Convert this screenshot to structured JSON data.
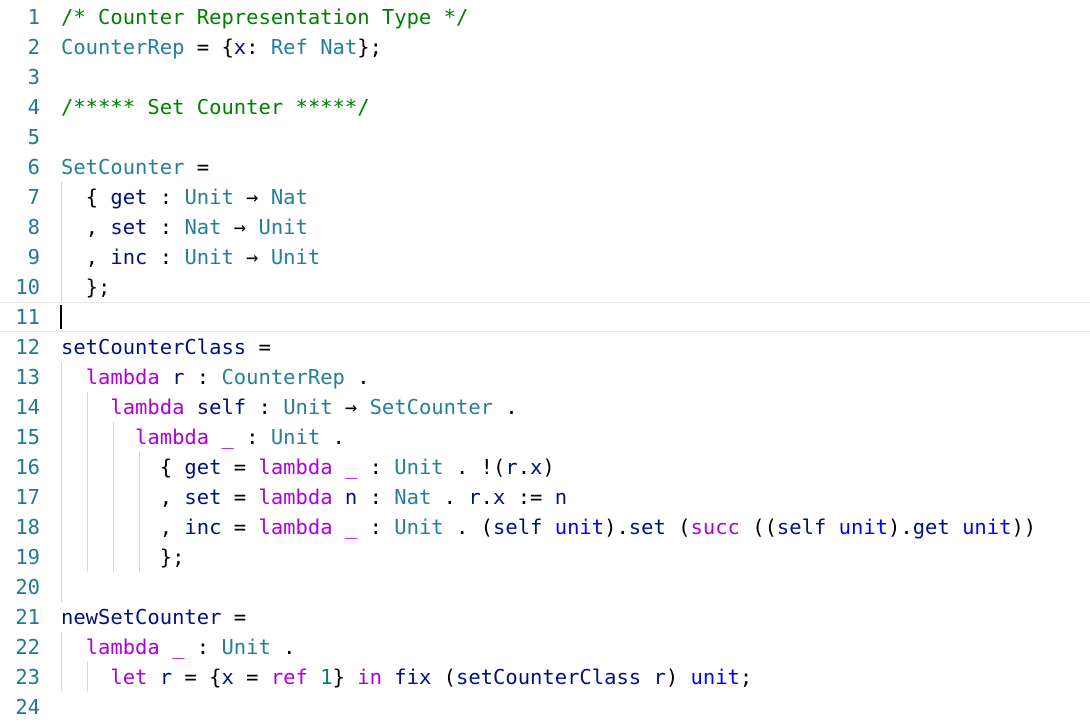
{
  "editor": {
    "current_line": 11,
    "colors": {
      "background": "#ffffff",
      "line_number": "#237893",
      "comment": "#008000",
      "type": "#267f99",
      "keyword": "#af00db",
      "identifier": "#001080",
      "builtin": "#0000ff",
      "number": "#098658"
    },
    "lines": [
      {
        "n": "1",
        "indent": 0,
        "tokens": [
          [
            "comment",
            "/* Counter Representation Type */"
          ]
        ]
      },
      {
        "n": "2",
        "indent": 0,
        "tokens": [
          [
            "type",
            "CounterRep"
          ],
          [
            "plain",
            " = {"
          ],
          [
            "var",
            "x"
          ],
          [
            "plain",
            ": "
          ],
          [
            "type",
            "Ref Nat"
          ],
          [
            "plain",
            "};"
          ]
        ]
      },
      {
        "n": "3",
        "indent": 0,
        "tokens": []
      },
      {
        "n": "4",
        "indent": 0,
        "tokens": [
          [
            "comment",
            "/***** Set Counter *****/"
          ]
        ]
      },
      {
        "n": "5",
        "indent": 0,
        "tokens": []
      },
      {
        "n": "6",
        "indent": 0,
        "tokens": [
          [
            "type",
            "SetCounter"
          ],
          [
            "plain",
            " ="
          ]
        ]
      },
      {
        "n": "7",
        "indent": 1,
        "tokens": [
          [
            "plain",
            "  { "
          ],
          [
            "var",
            "get"
          ],
          [
            "plain",
            " : "
          ],
          [
            "type",
            "Unit"
          ],
          [
            "plain",
            " → "
          ],
          [
            "type",
            "Nat"
          ]
        ]
      },
      {
        "n": "8",
        "indent": 1,
        "tokens": [
          [
            "plain",
            "  , "
          ],
          [
            "var",
            "set"
          ],
          [
            "plain",
            " : "
          ],
          [
            "type",
            "Nat"
          ],
          [
            "plain",
            " → "
          ],
          [
            "type",
            "Unit"
          ]
        ]
      },
      {
        "n": "9",
        "indent": 1,
        "tokens": [
          [
            "plain",
            "  , "
          ],
          [
            "var",
            "inc"
          ],
          [
            "plain",
            " : "
          ],
          [
            "type",
            "Unit"
          ],
          [
            "plain",
            " → "
          ],
          [
            "type",
            "Unit"
          ]
        ]
      },
      {
        "n": "10",
        "indent": 1,
        "tokens": [
          [
            "plain",
            "  };"
          ]
        ]
      },
      {
        "n": "11",
        "indent": 0,
        "tokens": []
      },
      {
        "n": "12",
        "indent": 0,
        "tokens": [
          [
            "var",
            "setCounterClass"
          ],
          [
            "plain",
            " ="
          ]
        ]
      },
      {
        "n": "13",
        "indent": 1,
        "tokens": [
          [
            "plain",
            "  "
          ],
          [
            "kw",
            "lambda"
          ],
          [
            "plain",
            " "
          ],
          [
            "var",
            "r"
          ],
          [
            "plain",
            " : "
          ],
          [
            "type",
            "CounterRep"
          ],
          [
            "plain",
            " ."
          ]
        ]
      },
      {
        "n": "14",
        "indent": 2,
        "tokens": [
          [
            "plain",
            "    "
          ],
          [
            "kw",
            "lambda"
          ],
          [
            "plain",
            " "
          ],
          [
            "var",
            "self"
          ],
          [
            "plain",
            " : "
          ],
          [
            "type",
            "Unit"
          ],
          [
            "plain",
            " → "
          ],
          [
            "type",
            "SetCounter"
          ],
          [
            "plain",
            " ."
          ]
        ]
      },
      {
        "n": "15",
        "indent": 3,
        "tokens": [
          [
            "plain",
            "      "
          ],
          [
            "kw",
            "lambda"
          ],
          [
            "plain",
            " "
          ],
          [
            "kw",
            "_"
          ],
          [
            "plain",
            " : "
          ],
          [
            "type",
            "Unit"
          ],
          [
            "plain",
            " ."
          ]
        ]
      },
      {
        "n": "16",
        "indent": 4,
        "tokens": [
          [
            "plain",
            "        { "
          ],
          [
            "var",
            "get"
          ],
          [
            "plain",
            " = "
          ],
          [
            "kw",
            "lambda"
          ],
          [
            "plain",
            " "
          ],
          [
            "kw",
            "_"
          ],
          [
            "plain",
            " : "
          ],
          [
            "type",
            "Unit"
          ],
          [
            "plain",
            " . !("
          ],
          [
            "var",
            "r"
          ],
          [
            "plain",
            "."
          ],
          [
            "var",
            "x"
          ],
          [
            "plain",
            ")"
          ]
        ]
      },
      {
        "n": "17",
        "indent": 4,
        "tokens": [
          [
            "plain",
            "        , "
          ],
          [
            "var",
            "set"
          ],
          [
            "plain",
            " = "
          ],
          [
            "kw",
            "lambda"
          ],
          [
            "plain",
            " "
          ],
          [
            "var",
            "n"
          ],
          [
            "plain",
            " : "
          ],
          [
            "type",
            "Nat"
          ],
          [
            "plain",
            " . "
          ],
          [
            "var",
            "r"
          ],
          [
            "plain",
            "."
          ],
          [
            "var",
            "x"
          ],
          [
            "plain",
            " := "
          ],
          [
            "var",
            "n"
          ]
        ]
      },
      {
        "n": "18",
        "indent": 4,
        "tokens": [
          [
            "plain",
            "        , "
          ],
          [
            "var",
            "inc"
          ],
          [
            "plain",
            " = "
          ],
          [
            "kw",
            "lambda"
          ],
          [
            "plain",
            " "
          ],
          [
            "kw",
            "_"
          ],
          [
            "plain",
            " : "
          ],
          [
            "type",
            "Unit"
          ],
          [
            "plain",
            " . ("
          ],
          [
            "var",
            "self"
          ],
          [
            "plain",
            " "
          ],
          [
            "blue",
            "unit"
          ],
          [
            "plain",
            ")."
          ],
          [
            "var",
            "set"
          ],
          [
            "plain",
            " ("
          ],
          [
            "kw",
            "succ"
          ],
          [
            "plain",
            " (("
          ],
          [
            "var",
            "self"
          ],
          [
            "plain",
            " "
          ],
          [
            "blue",
            "unit"
          ],
          [
            "plain",
            ")."
          ],
          [
            "var",
            "get"
          ],
          [
            "plain",
            " "
          ],
          [
            "blue",
            "unit"
          ],
          [
            "plain",
            "))"
          ]
        ]
      },
      {
        "n": "19",
        "indent": 4,
        "tokens": [
          [
            "plain",
            "        };"
          ]
        ]
      },
      {
        "n": "20",
        "indent": 1,
        "tokens": []
      },
      {
        "n": "21",
        "indent": 0,
        "tokens": [
          [
            "var",
            "newSetCounter"
          ],
          [
            "plain",
            " ="
          ]
        ]
      },
      {
        "n": "22",
        "indent": 1,
        "tokens": [
          [
            "plain",
            "  "
          ],
          [
            "kw",
            "lambda"
          ],
          [
            "plain",
            " "
          ],
          [
            "kw",
            "_"
          ],
          [
            "plain",
            " : "
          ],
          [
            "type",
            "Unit"
          ],
          [
            "plain",
            " ."
          ]
        ]
      },
      {
        "n": "23",
        "indent": 2,
        "tokens": [
          [
            "plain",
            "    "
          ],
          [
            "kw",
            "let"
          ],
          [
            "plain",
            " "
          ],
          [
            "var",
            "r"
          ],
          [
            "plain",
            " = {"
          ],
          [
            "var",
            "x"
          ],
          [
            "plain",
            " = "
          ],
          [
            "kw",
            "ref"
          ],
          [
            "plain",
            " "
          ],
          [
            "num",
            "1"
          ],
          [
            "plain",
            "} "
          ],
          [
            "kw",
            "in"
          ],
          [
            "plain",
            " "
          ],
          [
            "var",
            "fix"
          ],
          [
            "plain",
            " ("
          ],
          [
            "var",
            "setCounterClass"
          ],
          [
            "plain",
            " "
          ],
          [
            "var",
            "r"
          ],
          [
            "plain",
            ") "
          ],
          [
            "blue",
            "unit"
          ],
          [
            "plain",
            ";"
          ]
        ]
      },
      {
        "n": "24",
        "indent": 0,
        "tokens": []
      }
    ]
  }
}
